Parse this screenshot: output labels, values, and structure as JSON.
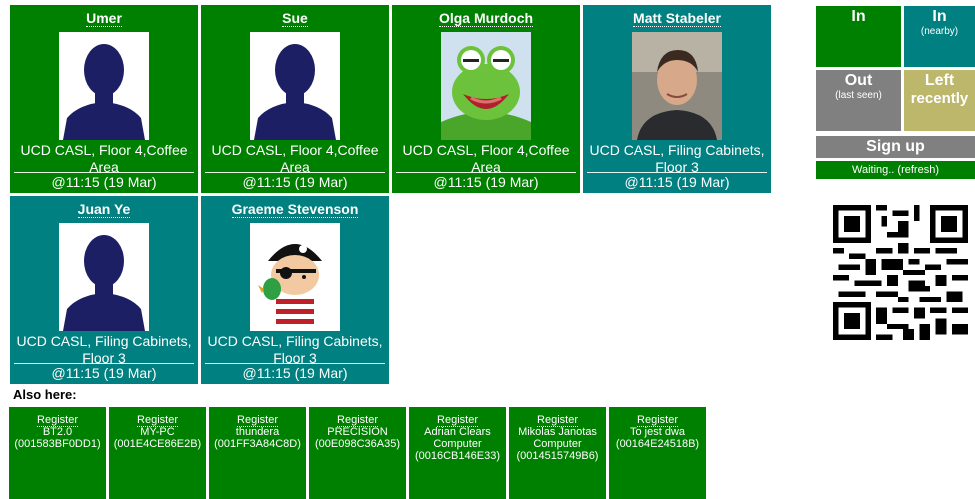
{
  "people": [
    {
      "name": "Umer",
      "location": "UCD CASL, Floor 4,Coffee Area",
      "time": "@11:15 (19 Mar)",
      "status": "in",
      "avatar": "silhouette"
    },
    {
      "name": "Sue",
      "location": "UCD CASL, Floor 4,Coffee Area",
      "time": "@11:15 (19 Mar)",
      "status": "in",
      "avatar": "silhouette"
    },
    {
      "name": "Olga Murdoch",
      "location": "UCD CASL, Floor 4,Coffee Area",
      "time": "@11:15 (19 Mar)",
      "status": "in",
      "avatar": "frog"
    },
    {
      "name": "Matt Stabeler",
      "location": "UCD CASL, Filing Cabinets, Floor 3",
      "time": "@11:15 (19 Mar)",
      "status": "nearby",
      "avatar": "man-photo"
    },
    {
      "name": "Juan Ye",
      "location": "UCD CASL, Filing Cabinets, Floor 3",
      "time": "@11:15 (19 Mar)",
      "status": "nearby",
      "avatar": "silhouette"
    },
    {
      "name": "Graeme Stevenson",
      "location": "UCD CASL, Filing Cabinets, Floor 3",
      "time": "@11:15 (19 Mar)",
      "status": "nearby",
      "avatar": "pirate"
    }
  ],
  "also_here": {
    "title": "Also here:",
    "devices": [
      {
        "action": "Register",
        "name": "BT2.0",
        "id": "(001583BF0DD1)"
      },
      {
        "action": "Register",
        "name": "MY-PC",
        "id": "(001E4CE86E2B)"
      },
      {
        "action": "Register",
        "name": "thundera",
        "id": "(001FF3A84C8D)"
      },
      {
        "action": "Register",
        "name": "PRECISION",
        "id": "(00E098C36A35)"
      },
      {
        "action": "Register",
        "name": "Adrian Clears Computer",
        "id": "(0016CB146E33)"
      },
      {
        "action": "Register",
        "name": "Mikolas Janotas Computer",
        "id": "(0014515749B6)"
      },
      {
        "action": "Register",
        "name": "To jest dwa",
        "id": "(00164E24518B)"
      }
    ]
  },
  "legend": {
    "in": {
      "label": "In",
      "sub": ""
    },
    "in_nearby": {
      "label": "In",
      "sub": "(nearby)"
    },
    "out": {
      "label": "Out",
      "sub": "(last seen)"
    },
    "left": {
      "label": "Left",
      "sub": "recently"
    }
  },
  "signup": {
    "label": "Sign up",
    "status": "Waiting.. (refresh)"
  },
  "colors": {
    "in": "#008000",
    "nearby": "#008080",
    "out": "#808080",
    "left": "#bdb76b"
  },
  "icons": {
    "qr": "qr-code-icon"
  }
}
